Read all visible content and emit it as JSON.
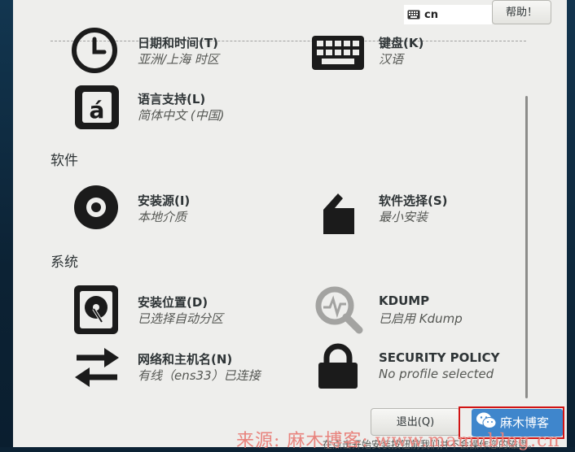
{
  "keyboard_indicator": {
    "label": "cn",
    "icon": "keyboard-icon"
  },
  "help_button": {
    "label": "帮助！"
  },
  "sections": {
    "software": "软件",
    "system": "系统"
  },
  "spokes": {
    "datetime": {
      "title": "日期和时间(T)",
      "status": "亚洲/上海 时区",
      "icon": "clock-icon"
    },
    "keyboard": {
      "title": "键盘(K)",
      "status": "汉语",
      "icon": "keyboard-icon"
    },
    "language": {
      "title": "语言支持(L)",
      "status": "简体中文 (中国)",
      "icon": "language-icon"
    },
    "source": {
      "title": "安装源(I)",
      "status": "本地介质",
      "icon": "disc-icon"
    },
    "software_selection": {
      "title": "软件选择(S)",
      "status": "最小安装",
      "icon": "package-icon"
    },
    "destination": {
      "title": "安装位置(D)",
      "status": "已选择自动分区",
      "icon": "hard-disk-icon"
    },
    "kdump": {
      "title": "KDUMP",
      "status": "已启用 Kdump",
      "icon": "magnifier-icon"
    },
    "network": {
      "title": "网络和主机名(N)",
      "status": "有线（ens33）已连接",
      "icon": "network-arrows-icon"
    },
    "security": {
      "title": "SECURITY POLICY",
      "status": "No profile selected",
      "icon": "lock-icon"
    }
  },
  "buttons": {
    "quit": "退出(Q)",
    "begin": ""
  },
  "watermark": {
    "badge_text": "麻木博客",
    "source_text": "来源: 麻木博客: www.mamublog.cn",
    "badge_icon": "wechat-icon"
  },
  "bottom_note": "在点击开始安装按钮前我们并不会操作您的磁盘。",
  "colors": {
    "panel_bg": "#eeeeec",
    "desktop_bg": "#0c2234",
    "accent_blue": "#3f86cc",
    "highlight_red": "#d11414",
    "watermark_red": "#e8837d"
  }
}
